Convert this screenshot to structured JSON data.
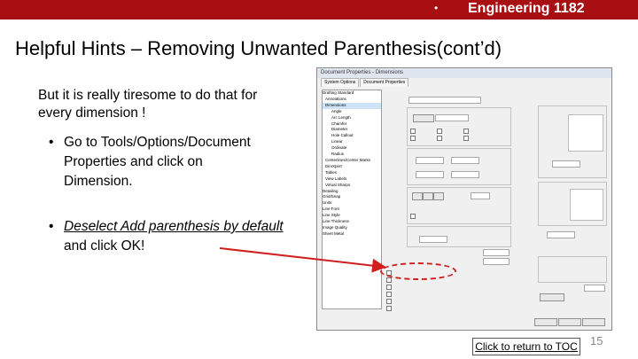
{
  "header": {
    "bullet": "•",
    "course": "Engineering 1182"
  },
  "slide": {
    "title": "Helpful Hints – Removing Unwanted Parenthesis(cont’d)",
    "intro": "But it is really tiresome to do that for every dimension !",
    "bullet_char": "•",
    "bullet1": "Go to Tools/Options/Document Properties and click on Dimension.",
    "bullet2_link": "Deselect Add parenthesis by default",
    "bullet2_rest": " and click OK!",
    "toc_link": "Click to return to TOC",
    "page_number": "15"
  },
  "dialog": {
    "title": "Document Properties - Dimensions",
    "tabs": [
      "System Options",
      "Document Properties"
    ],
    "tree_items": [
      "Drafting Standard",
      "Annotations",
      "Dimensions",
      "Angle",
      "Arc Length",
      "Chamfer",
      "Diameter",
      "Hole Callout",
      "Linear",
      "Ordinate",
      "Radius",
      "Centerlines/Center Marks",
      "DimXpert",
      "Tables",
      "View Labels",
      "Virtual Sharps",
      "Detailing",
      "Grid/Snap",
      "Units",
      "Line Font",
      "Line Style",
      "Line Thickness",
      "Image Quality",
      "Sheet Metal"
    ]
  },
  "colors": {
    "header_red": "#a70f12",
    "annotation_red": "#d01f1f"
  }
}
